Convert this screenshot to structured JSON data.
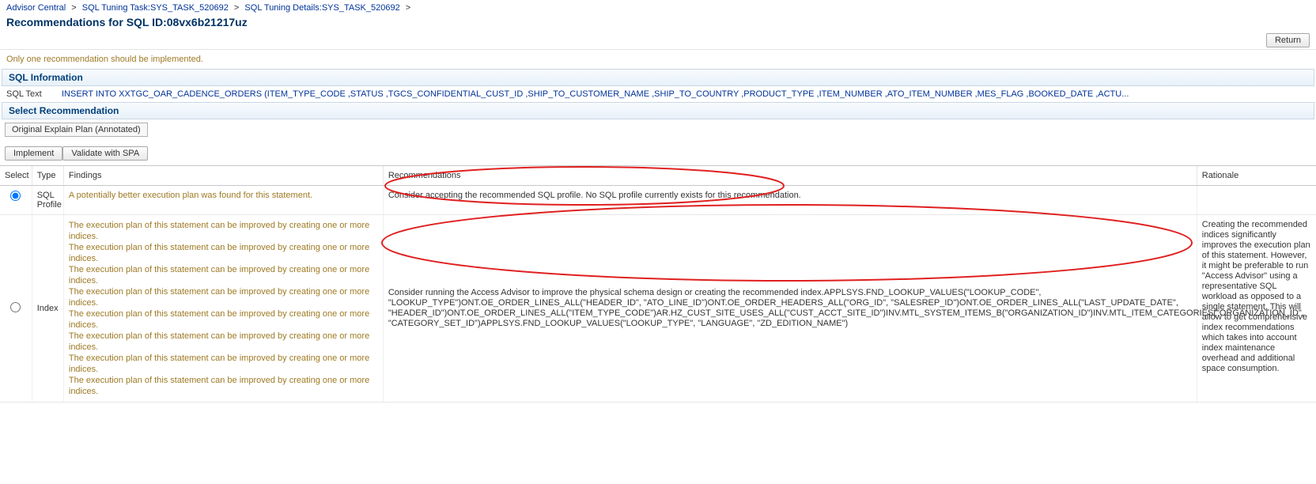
{
  "breadcrumb": {
    "items": [
      {
        "label": "Advisor Central"
      },
      {
        "label": "SQL Tuning Task:SYS_TASK_520692"
      },
      {
        "label": "SQL Tuning Details:SYS_TASK_520692"
      }
    ],
    "sep": ">"
  },
  "page_title": "Recommendations for SQL ID:08vx6b21217uz",
  "return_btn": "Return",
  "note": "Only one recommendation should be implemented.",
  "sql_info": {
    "header": "SQL Information",
    "text_label": "SQL Text",
    "text_value": "INSERT INTO XXTGC_OAR_CADENCE_ORDERS (ITEM_TYPE_CODE ,STATUS ,TGCS_CONFIDENTIAL_CUST_ID ,SHIP_TO_CUSTOMER_NAME ,SHIP_TO_COUNTRY ,PRODUCT_TYPE ,ITEM_NUMBER ,ATO_ITEM_NUMBER ,MES_FLAG ,BOOKED_DATE ,ACTU..."
  },
  "select_rec": {
    "header": "Select Recommendation",
    "orig_plan_btn": "Original Explain Plan (Annotated)",
    "implement_btn": "Implement",
    "validate_btn": "Validate with SPA"
  },
  "columns": {
    "select": "Select",
    "type": "Type",
    "findings": "Findings",
    "recommendations": "Recommendations",
    "rationale": "Rationale"
  },
  "rows": [
    {
      "selected": true,
      "type": "SQL Profile",
      "findings_single": "A potentially better execution plan was found for this statement.",
      "recommendation": "Consider accepting the recommended SQL profile. No SQL profile currently exists for this recommendation.",
      "rationale": ""
    },
    {
      "selected": false,
      "type": "Index",
      "findings_repeat": "The execution plan of this statement can be improved by creating one or more indices.",
      "findings_count": 8,
      "recommendation": "Consider running the Access Advisor to improve the physical schema design or creating the recommended index.APPLSYS.FND_LOOKUP_VALUES(\"LOOKUP_CODE\", \"LOOKUP_TYPE\")ONT.OE_ORDER_LINES_ALL(\"HEADER_ID\", \"ATO_LINE_ID\")ONT.OE_ORDER_HEADERS_ALL(\"ORG_ID\", \"SALESREP_ID\")ONT.OE_ORDER_LINES_ALL(\"LAST_UPDATE_DATE\", \"HEADER_ID\")ONT.OE_ORDER_LINES_ALL(\"ITEM_TYPE_CODE\")AR.HZ_CUST_SITE_USES_ALL(\"CUST_ACCT_SITE_ID\")INV.MTL_SYSTEM_ITEMS_B(\"ORGANIZATION_ID\")INV.MTL_ITEM_CATEGORIES(\"ORGANIZATION_ID\", \"CATEGORY_SET_ID\")APPLSYS.FND_LOOKUP_VALUES(\"LOOKUP_TYPE\", \"LANGUAGE\", \"ZD_EDITION_NAME\")",
      "rationale": "Creating the recommended indices significantly improves the execution plan of this statement. However, it might be preferable to run \"Access Advisor\" using a representative SQL workload as opposed to a single statement. This will allow to get comprehensive index recommendations which takes into account index maintenance overhead and additional space consumption."
    }
  ]
}
